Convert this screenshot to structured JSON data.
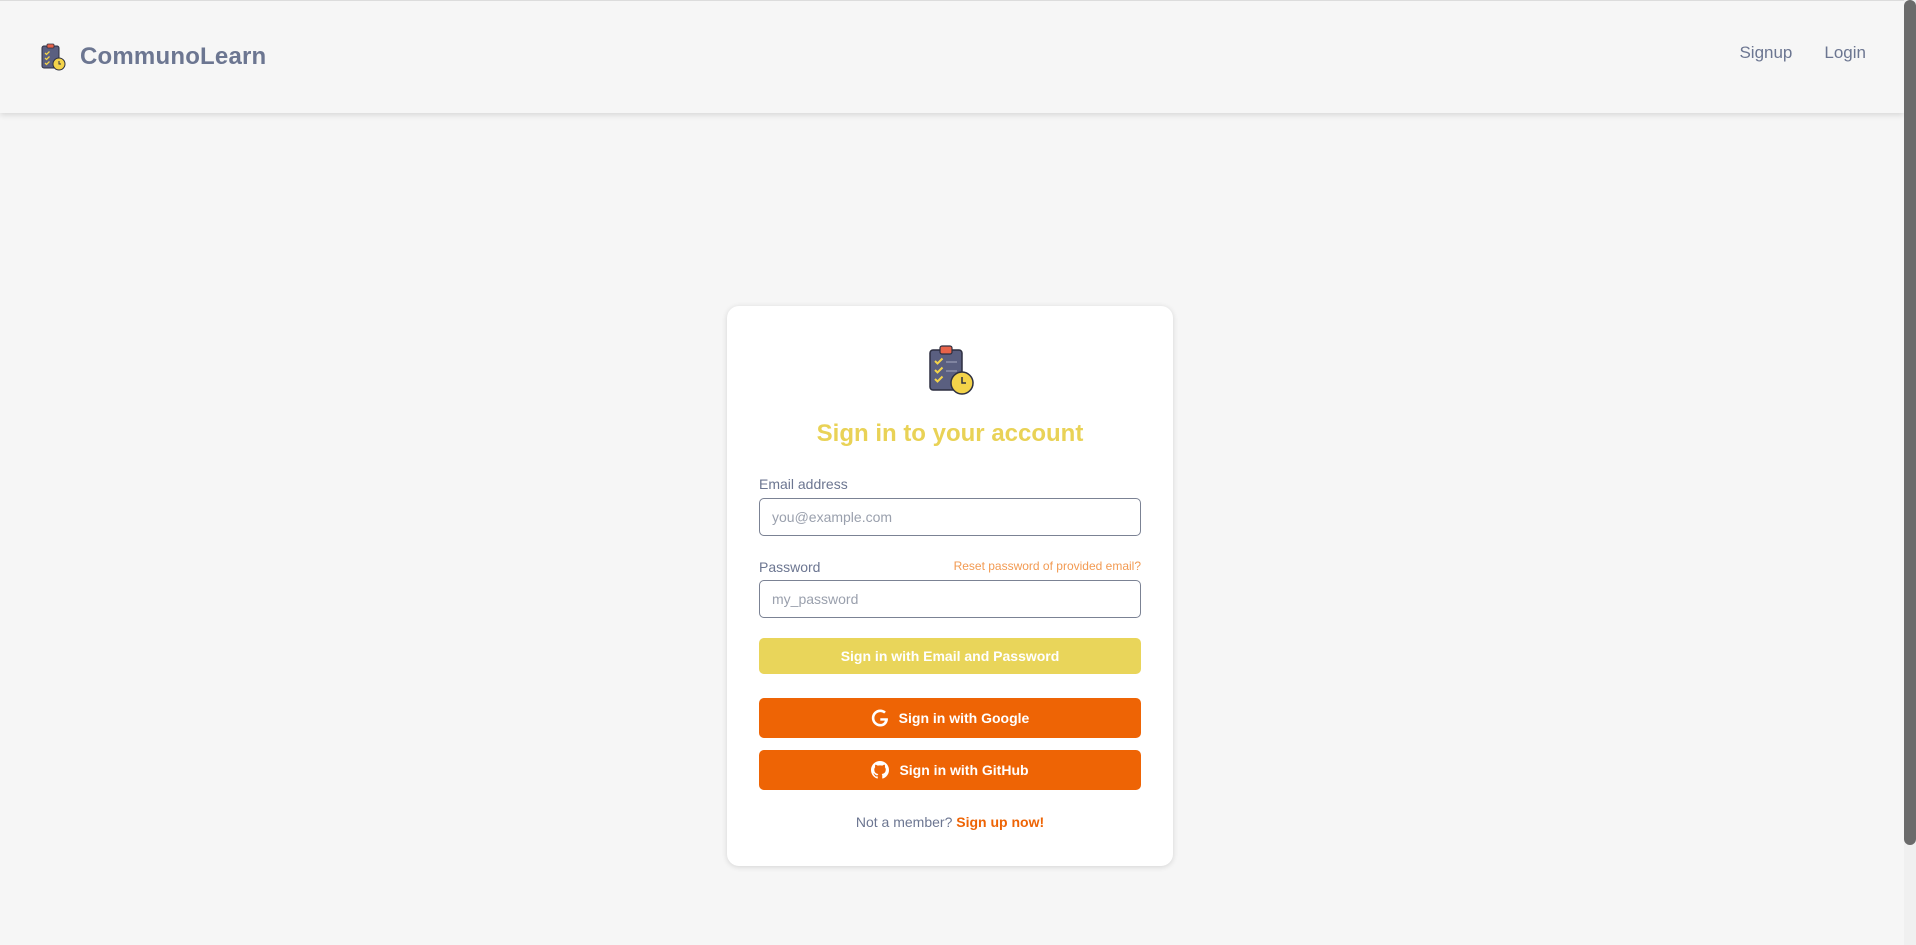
{
  "navbar": {
    "brand_name": "CommunoLearn",
    "links": [
      {
        "label": "Signup"
      },
      {
        "label": "Login"
      }
    ]
  },
  "login_card": {
    "title": "Sign in to your account",
    "email": {
      "label": "Email address",
      "placeholder": "you@example.com",
      "value": ""
    },
    "password": {
      "label": "Password",
      "placeholder": "my_password",
      "value": "",
      "reset_link": "Reset password of provided email?"
    },
    "buttons": {
      "email_signin": "Sign in with Email and Password",
      "google_signin": "Sign in with Google",
      "github_signin": "Sign in with GitHub"
    },
    "footer": {
      "prompt": "Not a member?",
      "signup_link": "Sign up now!"
    }
  },
  "colors": {
    "brand_text": "#6c7691",
    "title_yellow": "#e9d256",
    "email_button": "#e9d55a",
    "oauth_button": "#ee6405",
    "reset_link": "#f29a52",
    "background": "#f6f6f6"
  },
  "icons": {
    "brand": "clipboard-clock-icon",
    "google": "google-icon",
    "github": "github-icon"
  }
}
